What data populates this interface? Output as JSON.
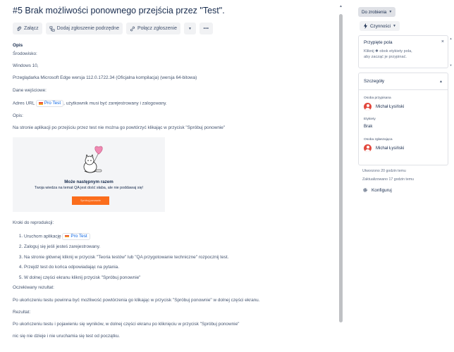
{
  "issue": {
    "title": "#5 Brak możliwości ponownego przejścia przez \"Test\"."
  },
  "toolbar": {
    "attach_label": "Załącz",
    "add_subtask_label": "Dodaj zgłoszenie podrzędne",
    "link_issue_label": "Połącz zgłoszenie",
    "more_label": "•••"
  },
  "description": {
    "heading": "Opis",
    "env_label": "Środowisko:",
    "os": "Windows 10,",
    "browser": "Przeglądarka Microsoft Edge wersja 112.0.1722.34 (Oficjalna kompilacja) (wersja 64-bitowa)",
    "input_label": "Dane wejściowe:",
    "url_prefix": "Adres URL",
    "url_chip": "Pro Test",
    "url_suffix": ", użytkownik musi być zarejestrowany i zalogowany.",
    "opis_label": "Opis:",
    "opis_text": " Na stronie aplikacji po przejściu przez test nie można go powtórzyć klikając w przycisk \"Spróbuj ponownie\"",
    "banner": {
      "heading": "Może następnym razem",
      "subtext": "Twoja wiedza na temat QA jest dość słaba, ale nie poddawaj się!",
      "button": "Spróbuj ponownie"
    },
    "steps_label": "Kroki do reprodukcji:",
    "steps": {
      "s1_prefix": "Uruchom aplikację",
      "s1_chip": "Pro Test",
      "s2": "Zaloguj się jeśli jesteś zarejestrowany.",
      "s3": "Na stronie głównej kliknij w przycisk \"Teoria testów\" lub \"QA przygotowanie techniczne\"    rozpocznij test.",
      "s4": "Przejdź test do końca odpowiadając na pytania.",
      "s5": "W dolnej części ekranu kliknij przycisk \"Spróbuj ponownie\""
    },
    "expected_label": "Oczekiwany rezultat:",
    "expected_text": "Po ukończeniu testu powinna być możliwość powtórzenia go klikając w przycisk \"Spróbuj ponownie\" w dolnej części ekranu.",
    "result_label": "Rezultat:",
    "result_text": "Po ukończeniu testu i pojawieniu się wyników, w dolnej części ekranu po kliknięciu w przycisk \"Spróbuj ponownie\"",
    "result_text2": " nic się nie dzieje i nie uruchamia się test od początku."
  },
  "sidebar": {
    "status_label": "Do zrobienia",
    "actions_label": "Czynności",
    "pinned": {
      "title": "Przypięte pola",
      "text_line1": "Kliknij ✱ obok etykiety pola,",
      "text_line2": "aby zacząć je przypinać.",
      "close": "×"
    },
    "details": {
      "title": "Szczegóły",
      "assignee_label": "Osoba przypisana",
      "assignee_name": "Michał Łysiński",
      "labels_label": "Etykiety",
      "labels_value": "Brak",
      "reporter_label": "Osoba zgłaszająca",
      "reporter_name": "Michał Łysiński"
    },
    "created": "Utworzono 20 godzin temu",
    "updated": "Zaktualizowano 17 godzin temu",
    "configure_label": "Konfiguruj"
  },
  "colors": {
    "accent": "#0c66e4",
    "text": "#172b4d",
    "muted": "#44546f",
    "banner_button": "#fb6d1c"
  }
}
